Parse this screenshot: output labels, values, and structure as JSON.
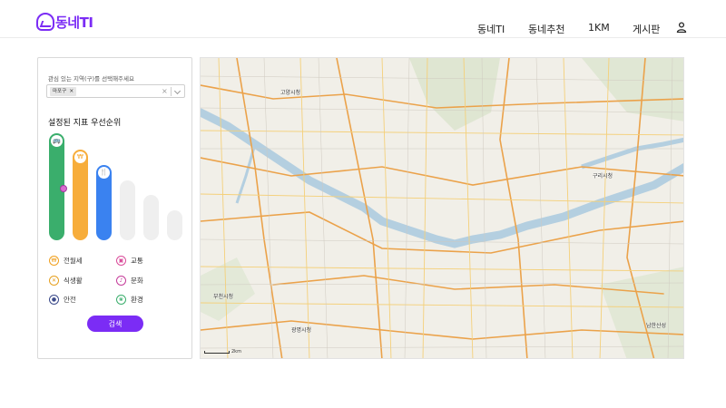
{
  "brand": {
    "logo_text": "동네TI",
    "accent": "#7b2cf5"
  },
  "nav": {
    "items": [
      {
        "label": "동네TI"
      },
      {
        "label": "동네추천"
      },
      {
        "label": "1KM"
      },
      {
        "label": "게시판"
      }
    ],
    "user_icon": "user-icon"
  },
  "filter": {
    "region_label": "관심 있는 지역(구)를 선택해주세요",
    "selected_region": "마포구",
    "chip_remove": "×",
    "clear": "×",
    "priority_title": "설정된 지표 우선순위",
    "bars": [
      {
        "name": "교통",
        "fill": 1.0,
        "color": "#3aae6c",
        "icon": "bus-icon",
        "glyph": "🚌"
      },
      {
        "name": "전월세",
        "fill": 0.85,
        "color": "#f7ad3b",
        "icon": "coin-icon",
        "glyph": "₩"
      },
      {
        "name": "식생활",
        "fill": 0.7,
        "color": "#3a82f0",
        "icon": "fork-knife-icon",
        "glyph": "🍴"
      },
      {
        "name": "",
        "fill": 0.56,
        "color": "#efefef",
        "icon": "",
        "glyph": ""
      },
      {
        "name": "",
        "fill": 0.42,
        "color": "#efefef",
        "icon": "",
        "glyph": ""
      },
      {
        "name": "",
        "fill": 0.28,
        "color": "#efefef",
        "icon": "",
        "glyph": ""
      }
    ],
    "legend": [
      {
        "label": "전월세",
        "icon": "coin-icon",
        "glyph": "₩",
        "color": "#f0a020"
      },
      {
        "label": "교통",
        "icon": "bus-icon",
        "glyph": "▣",
        "color": "#d94c9a"
      },
      {
        "label": "식생활",
        "icon": "fork-knife-icon",
        "glyph": "✕",
        "color": "#e6a020"
      },
      {
        "label": "문화",
        "icon": "music-icon",
        "glyph": "♪",
        "color": "#c53c9a"
      },
      {
        "label": "안전",
        "icon": "shield-icon",
        "glyph": "●",
        "color": "#3b4a8a"
      },
      {
        "label": "환경",
        "icon": "leaf-icon",
        "glyph": "❀",
        "color": "#3aae6c"
      }
    ],
    "search_button": "검색"
  },
  "map": {
    "labels": [
      {
        "text": "고양시청"
      },
      {
        "text": "구리시청"
      },
      {
        "text": "부천시청"
      },
      {
        "text": "광명시청"
      },
      {
        "text": "남한산성"
      }
    ],
    "scale_text": "2km"
  }
}
